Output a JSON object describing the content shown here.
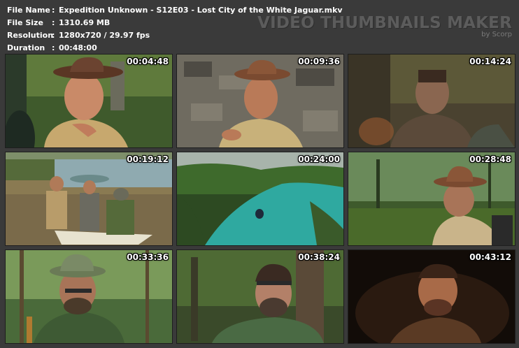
{
  "file_info": {
    "rows": [
      {
        "key": "File Name",
        "sep": ":",
        "value": "Expedition Unknown - S12E03 - Lost City of the White Jaguar.mkv"
      },
      {
        "key": "File Size",
        "sep": ":",
        "value": "1310.69 MB"
      },
      {
        "key": "Resolution",
        "sep": ":",
        "value": "1280x720 / 29.97 fps"
      },
      {
        "key": "Duration",
        "sep": ":",
        "value": "00:48:00"
      }
    ]
  },
  "brand": {
    "title": "VIDEO THUMBNAILS MAKER",
    "subtitle": "by Scorp"
  },
  "thumbnails": [
    {
      "timestamp": "00:04:48"
    },
    {
      "timestamp": "00:09:36"
    },
    {
      "timestamp": "00:14:24"
    },
    {
      "timestamp": "00:19:12"
    },
    {
      "timestamp": "00:24:00"
    },
    {
      "timestamp": "00:28:48"
    },
    {
      "timestamp": "00:33:36"
    },
    {
      "timestamp": "00:38:24"
    },
    {
      "timestamp": "00:43:12"
    }
  ]
}
